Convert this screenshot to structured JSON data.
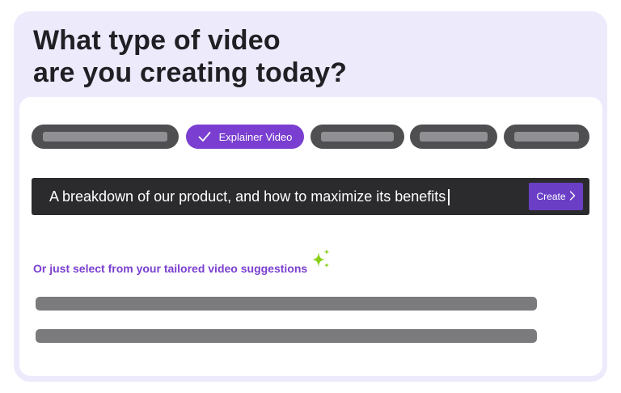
{
  "heading": {
    "line1": "What type of video",
    "line2": "are you creating today?"
  },
  "video_types": {
    "selected_label": "Explainer Video",
    "placeholder_count_left": 1,
    "placeholder_count_right": 3
  },
  "prompt": {
    "value": "A breakdown of our product, and how to maximize its benefits",
    "create_label": "Create"
  },
  "suggestions": {
    "label": "Or just select from your tailored video suggestions",
    "items_count": 2
  },
  "colors": {
    "card_bg": "#edeafc",
    "accent": "#7a3fd0",
    "sparkle": "#8ccf1a",
    "input_bg": "#2b2b2e"
  },
  "icons": {
    "selected_chip": "checkmark-icon",
    "create": "chevron-right-icon",
    "suggestions": "sparkle-icon"
  }
}
